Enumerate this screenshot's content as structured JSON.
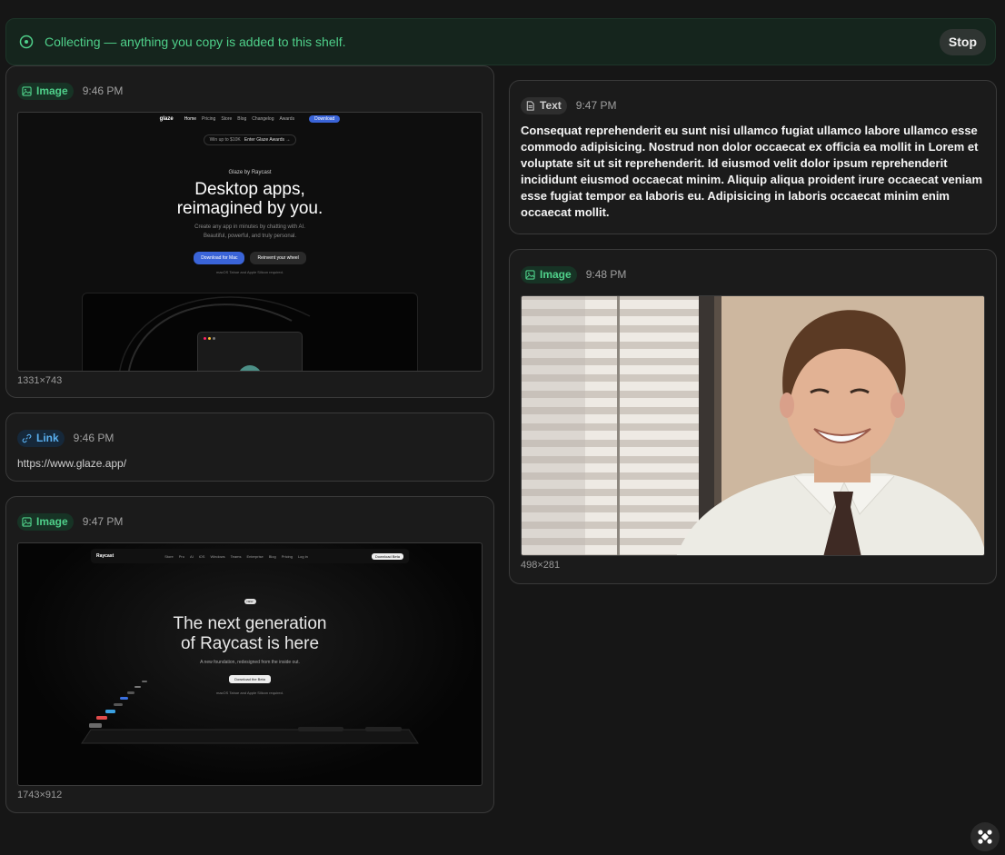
{
  "banner": {
    "icon": "record-circle-icon",
    "message": "Collecting — anything you copy is added to this shelf.",
    "stop_label": "Stop"
  },
  "cards": [
    {
      "type_label": "Image",
      "time": "9:46 PM",
      "dims": "1331×743",
      "preview": {
        "nav_items": [
          "Home",
          "Pricing",
          "Store",
          "Blog",
          "Changelog",
          "Awards"
        ],
        "nav_cta": "Download",
        "logo": "glaze",
        "award_pill_1": "Win up to $10K",
        "award_pill_2": "Enter Glaze Awards →",
        "eyebrow": "Glaze by Raycast",
        "headline_1": "Desktop apps,",
        "headline_2": "reimagined by you.",
        "sub_1": "Create any app in minutes by chatting with AI.",
        "sub_2": "Beautiful, powerful, and truly personal.",
        "cta_primary": "Download for Mac",
        "cta_secondary": "Reinvent your wheel",
        "req": "macOS Tahoe and Apple Silicon required."
      }
    },
    {
      "type_label": "Link",
      "time": "9:46 PM",
      "url": "https://www.glaze.app/"
    },
    {
      "type_label": "Image",
      "time": "9:47 PM",
      "dims": "1743×912",
      "preview": {
        "logo": "Raycast",
        "nav_items": [
          "Store",
          "Pro",
          "AI",
          "iOS",
          "Windows",
          "Teams",
          "Enterprise",
          "Blog",
          "Pricing",
          "Log in"
        ],
        "nav_cta": "Download Beta",
        "tag": "NEW",
        "headline_1": "The next generation",
        "headline_2": "of Raycast is here",
        "sub": "A new foundation, redesigned from the inside out.",
        "cta": "Download the Beta",
        "req": "macOS Tahoe and Apple Silicon required."
      }
    },
    {
      "type_label": "Text",
      "time": "9:47 PM",
      "body": "Consequat reprehenderit eu sunt nisi ullamco fugiat ullamco labore ullamco esse commodo adipisicing. Nostrud non dolor occaecat ex officia ea mollit in Lorem et voluptate sit ut sit reprehenderit. Id eiusmod velit dolor ipsum reprehenderit incididunt eiusmod occaecat minim. Aliquip aliqua proident irure occaecat veniam esse fugiat tempor ea laboris eu. Adipisicing in laboris occaecat minim enim occaecat mollit."
    },
    {
      "type_label": "Image",
      "time": "9:48 PM",
      "dims": "498×281"
    }
  ],
  "colors": {
    "accent_green": "#4fd08a",
    "link_blue": "#5ab0f0",
    "background": "#161616"
  },
  "fab": {
    "icon": "raycast-logo-icon"
  }
}
